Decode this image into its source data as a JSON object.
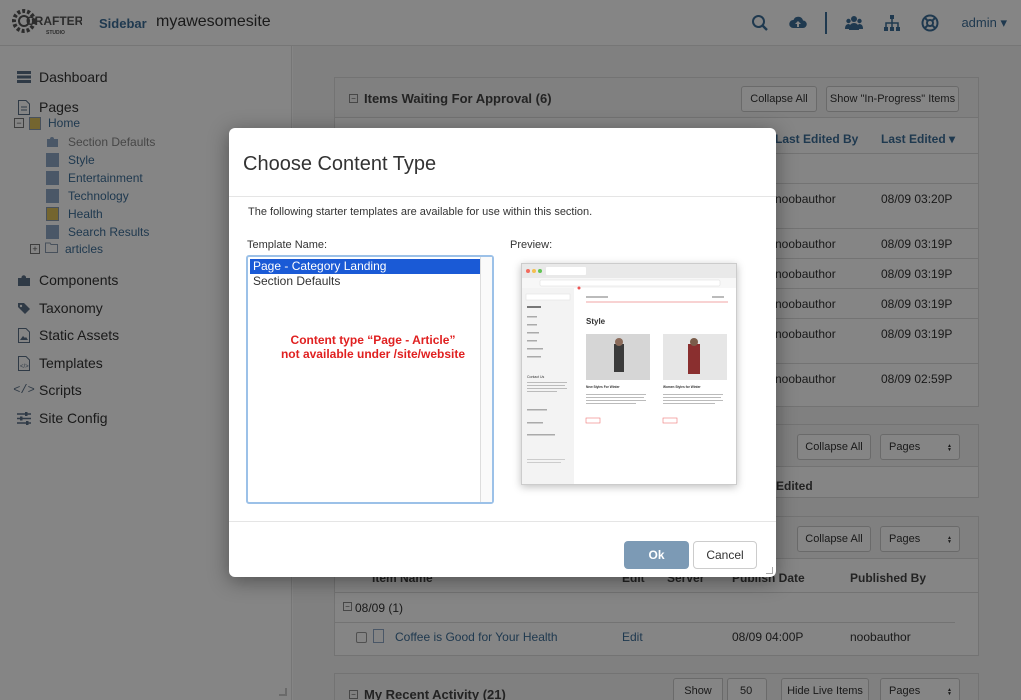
{
  "topbar": {
    "logo_text": "CRAFTER",
    "logo_sub": "STUDIO",
    "sidebar_link": "Sidebar",
    "site_name": "myawesomesite",
    "user": "admin"
  },
  "sidebar": {
    "dashboard": "Dashboard",
    "pages": "Pages",
    "home": "Home",
    "tree": [
      "Section Defaults",
      "Style",
      "Entertainment",
      "Technology",
      "Health",
      "Search Results",
      "articles"
    ],
    "components": "Components",
    "taxonomy": "Taxonomy",
    "static_assets": "Static Assets",
    "templates": "Templates",
    "scripts": "Scripts",
    "site_config": "Site Config"
  },
  "approval": {
    "title": "Items Waiting For Approval (6)",
    "collapse": "Collapse All",
    "show_inprogress": "Show \"In-Progress\" Items",
    "col_last_edited_by": "Last Edited By",
    "col_last_edited": "Last Edited ▾",
    "rows": [
      {
        "author": "noobauthor",
        "date": "08/09 03:20P"
      },
      {
        "author": "noobauthor",
        "date": "08/09 03:19P"
      },
      {
        "author": "noobauthor",
        "date": "08/09 03:19P"
      },
      {
        "author": "noobauthor",
        "date": "08/09 03:19P"
      },
      {
        "author": "noobauthor",
        "date": "08/09 03:19P"
      },
      {
        "author": "noobauthor",
        "date": "08/09 02:59P"
      }
    ]
  },
  "scheduled": {
    "collapse": "Collapse All",
    "filter": "Pages",
    "col_edited": "Edited"
  },
  "published": {
    "collapse": "Collapse All",
    "filter": "Pages",
    "col_item_name": "Item Name",
    "col_edit": "Edit",
    "col_server": "Server",
    "col_publish_date": "Publish Date",
    "col_published_by": "Published By",
    "group": "08/09 (1)",
    "row": {
      "name": "Coffee is Good for Your Health",
      "edit": "Edit",
      "date": "08/09 04:00P",
      "by": "noobauthor"
    }
  },
  "recent": {
    "title": "My Recent Activity (21)",
    "show": "Show",
    "count": "50",
    "hide_live": "Hide Live Items",
    "filter": "Pages"
  },
  "modal": {
    "title": "Choose Content Type",
    "description": "The following starter templates are available for use within this section.",
    "template_label": "Template Name:",
    "preview_label": "Preview:",
    "options": [
      "Page - Category Landing",
      "Section Defaults"
    ],
    "note_line1": "Content type “Page - Article”",
    "note_line2": "not available under /site/website",
    "ok": "Ok",
    "cancel": "Cancel",
    "preview": {
      "section": "Style",
      "card1": "New Styles For Winter",
      "card2": "Women Styles for Winter",
      "contact": "Contact Us"
    }
  },
  "colors": {
    "link": "#3d6e98",
    "note": "#e02020",
    "selected": "#1a5ad6",
    "ok_button": "#7c9ab5"
  }
}
